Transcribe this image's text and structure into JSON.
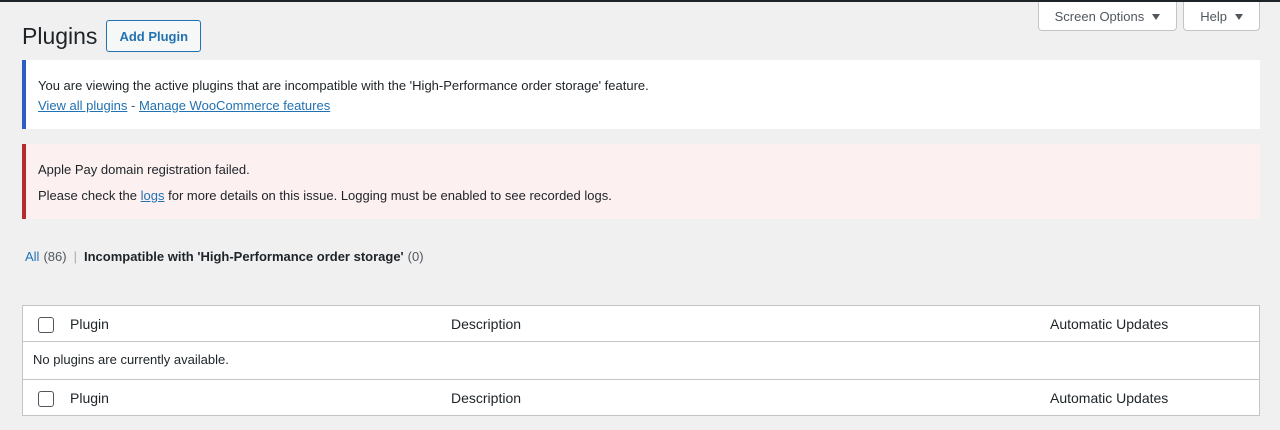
{
  "screen_meta": {
    "screen_options_label": "Screen Options",
    "help_label": "Help"
  },
  "header": {
    "title": "Plugins",
    "add_plugin_label": "Add Plugin"
  },
  "notices": {
    "info": {
      "message": "You are viewing the active plugins that are incompatible with the 'High-Performance order storage' feature.",
      "link_all": "View all plugins",
      "separator": "-",
      "link_manage": "Manage WooCommerce features"
    },
    "error": {
      "message": "Apple Pay domain registration failed.",
      "check_prefix": "Please check the",
      "logs_link": "logs",
      "check_suffix": "for more details on this issue. Logging must be enabled to see recorded logs."
    }
  },
  "filters": {
    "all_label": "All",
    "all_count": "(86)",
    "separator": "|",
    "incompatible_label": "Incompatible with 'High-Performance order storage'",
    "incompatible_count": "(0)"
  },
  "table": {
    "columns": {
      "plugin": "Plugin",
      "description": "Description",
      "auto_updates": "Automatic Updates"
    },
    "empty_message": "No plugins are currently available."
  },
  "colors": {
    "accent": "#2271b1",
    "info_border": "#2c5cc5",
    "error_border": "#b32d2e",
    "error_bg": "#fcf0f1"
  }
}
